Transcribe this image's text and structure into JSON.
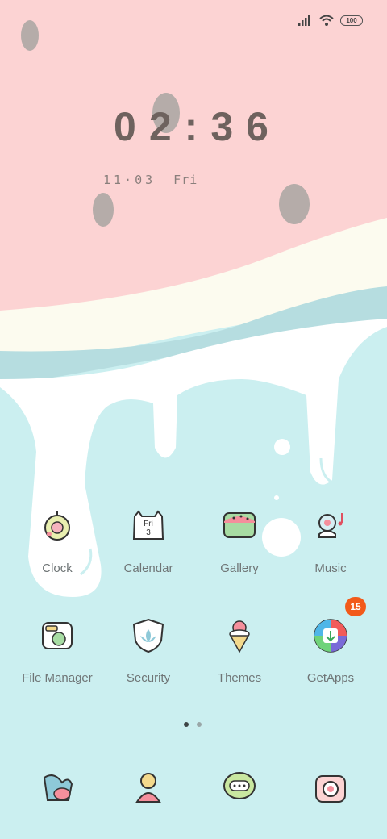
{
  "status_bar": {
    "battery": "100",
    "signal_icon": "signal-icon",
    "wifi_icon": "wifi-icon"
  },
  "clock": {
    "time": "02:36",
    "date": "11·03",
    "day": "Fri"
  },
  "apps": [
    {
      "label": "Clock",
      "icon": "clock-icon"
    },
    {
      "label": "Calendar",
      "icon": "calendar-icon",
      "icon_text": "Fri",
      "icon_num": "3"
    },
    {
      "label": "Gallery",
      "icon": "gallery-icon"
    },
    {
      "label": "Music",
      "icon": "music-icon"
    },
    {
      "label": "File Manager",
      "icon": "file-manager-icon"
    },
    {
      "label": "Security",
      "icon": "security-icon"
    },
    {
      "label": "Themes",
      "icon": "themes-icon"
    },
    {
      "label": "GetApps",
      "icon": "getapps-icon",
      "badge": "15"
    }
  ],
  "page_indicator": {
    "pages": 2,
    "current": 1
  },
  "dock": [
    "phone-icon",
    "contacts-icon",
    "messages-icon",
    "camera-icon"
  ],
  "colors": {
    "pink": "#fcd3d3",
    "cream": "#fcfbef",
    "teal": "#cbeff0",
    "badge": "#f25a1a"
  }
}
